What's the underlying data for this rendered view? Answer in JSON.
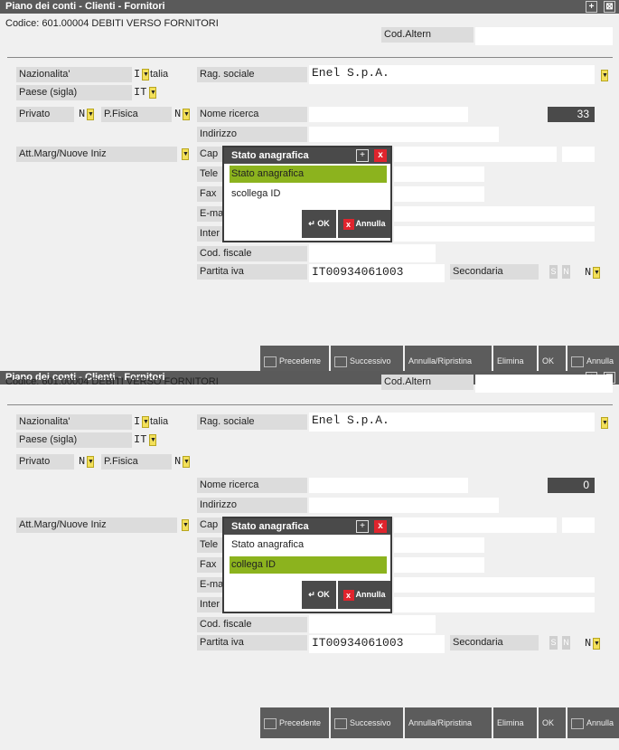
{
  "panels": [
    {
      "title": "Piano dei conti - Clienti - Fornitori",
      "codice_label": "Codice: 601.00004 DEBITI VERSO FORNITORI",
      "cod_altern_label": "Cod.Altern",
      "nazionalita_label": "Nazionalita'",
      "nazionalita_code": "I",
      "nazionalita_value": "talia",
      "paese_label": "Paese (sigla)",
      "paese_value": "IT",
      "privato_label": "Privato",
      "privato_value": "N",
      "pfisica_label": "P.Fisica",
      "pfisica_value": "N",
      "att_marg_label": "Att.Marg/Nuove Iniz",
      "rag_sociale_label": "Rag. sociale",
      "rag_sociale_value": "Enel S.p.A.",
      "nome_ricerca_label": "Nome ricerca",
      "counter_value": "33",
      "indirizzo_label": "Indirizzo",
      "cap_label": "Cap",
      "tele_label": "Tele",
      "fax_label": "Fax",
      "email_label": "E-ma",
      "inter_label": "Inter",
      "cod_fiscale_label": "Cod. fiscale",
      "partita_iva_label": "Partita iva",
      "partita_iva_value": "IT00934061003",
      "secondaria_label": "Secondaria",
      "secondaria_s": "S",
      "secondaria_n": "N",
      "secondaria_value": "N",
      "dialog": {
        "title": "Stato anagrafica",
        "options": [
          "Stato anagrafica",
          "scollega ID"
        ],
        "selected_index": 0,
        "ok_label": "OK",
        "cancel_label": "Annulla"
      },
      "toolbar": {
        "precedente": "Precedente",
        "successivo": "Successivo",
        "annulla_ripristina": "Annulla/Ripristina",
        "elimina": "Elimina",
        "ok": "OK",
        "annulla": "Annulla"
      }
    },
    {
      "title": "Piano dei conti - Clienti - Fornitori",
      "codice_label": "Codice: 601.00004 DEBITI VERSO FORNITORI",
      "cod_altern_label": "Cod.Altern",
      "nazionalita_label": "Nazionalita'",
      "nazionalita_code": "I",
      "nazionalita_value": "talia",
      "paese_label": "Paese (sigla)",
      "paese_value": "IT",
      "privato_label": "Privato",
      "privato_value": "N",
      "pfisica_label": "P.Fisica",
      "pfisica_value": "N",
      "att_marg_label": "Att.Marg/Nuove Iniz",
      "rag_sociale_label": "Rag. sociale",
      "rag_sociale_value": "Enel S.p.A.",
      "nome_ricerca_label": "Nome ricerca",
      "counter_value": "0",
      "indirizzo_label": "Indirizzo",
      "cap_label": "Cap",
      "tele_label": "Tele",
      "fax_label": "Fax",
      "email_label": "E-ma",
      "inter_label": "Inter",
      "cod_fiscale_label": "Cod. fiscale",
      "partita_iva_label": "Partita iva",
      "partita_iva_value": "IT00934061003",
      "secondaria_label": "Secondaria",
      "secondaria_s": "S",
      "secondaria_n": "N",
      "secondaria_value": "N",
      "dialog": {
        "title": "Stato anagrafica",
        "options": [
          "Stato anagrafica",
          "collega ID"
        ],
        "selected_index": 1,
        "ok_label": "OK",
        "cancel_label": "Annulla"
      },
      "toolbar": {
        "precedente": "Precedente",
        "successivo": "Successivo",
        "annulla_ripristina": "Annulla/Ripristina",
        "elimina": "Elimina",
        "ok": "OK",
        "annulla": "Annulla"
      }
    }
  ],
  "icons": {
    "dropdown": "chevron-down-icon",
    "maximize": "maximize-icon",
    "close": "close-icon",
    "ok": "enter-arrow-icon"
  },
  "colors": {
    "title_bar": "#5a5a5a",
    "selection": "#8cb31e",
    "dropdown": "#f3e05a",
    "close_red": "#e0242d"
  }
}
